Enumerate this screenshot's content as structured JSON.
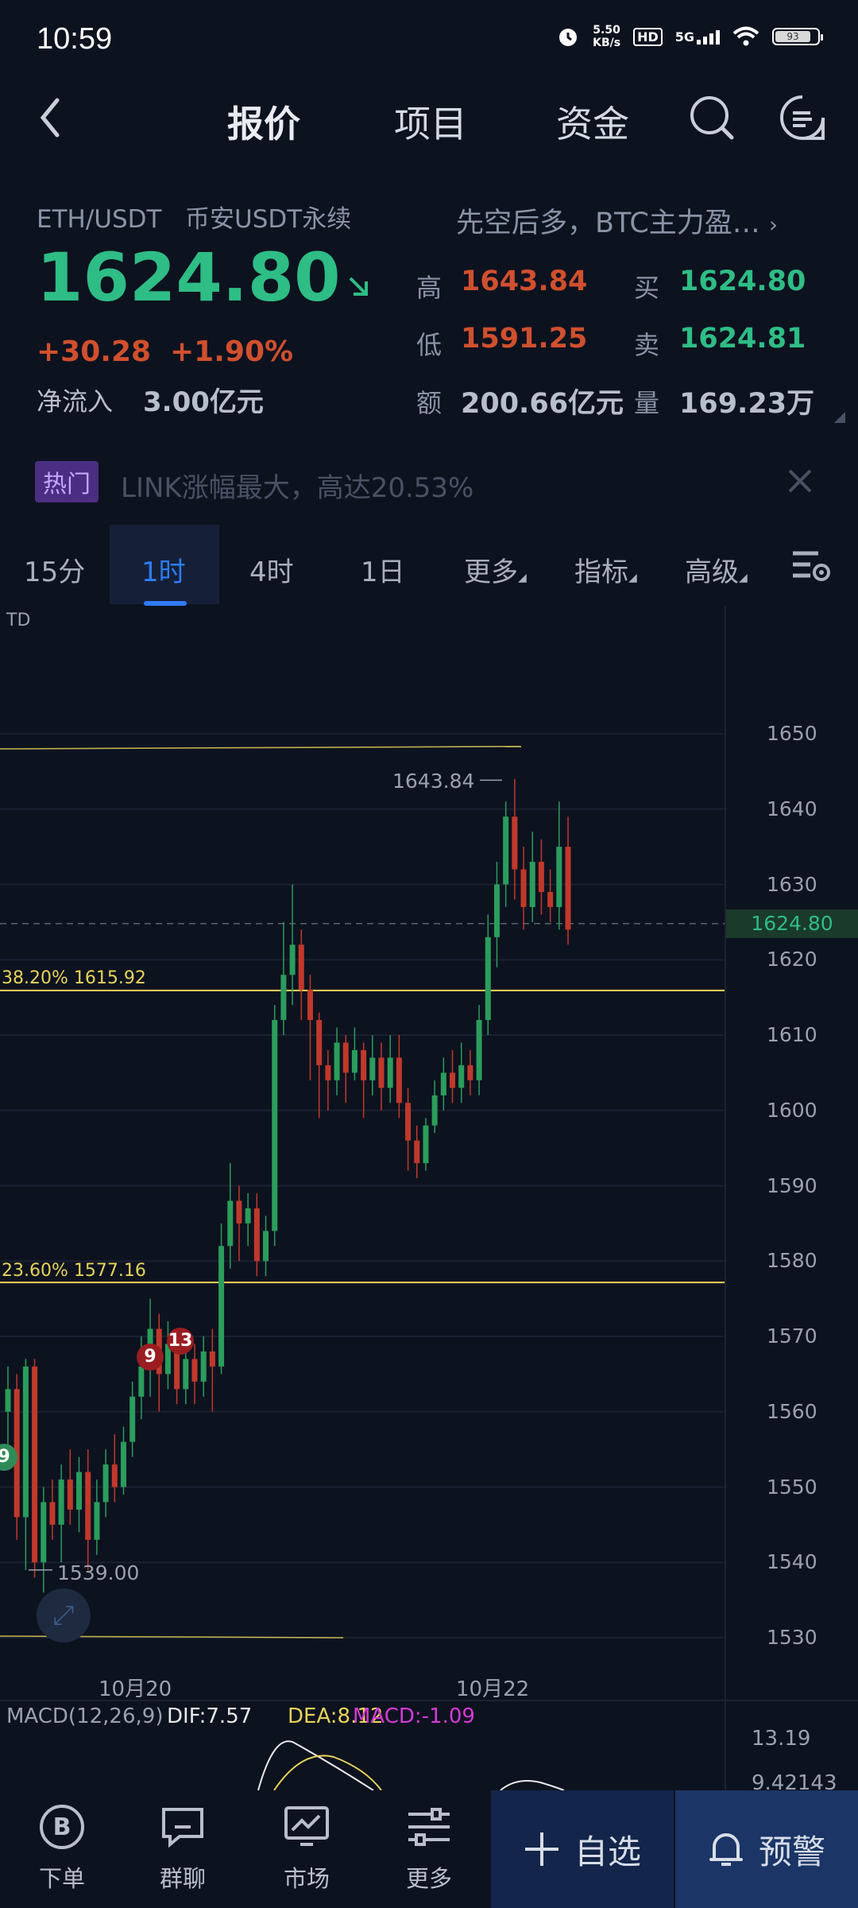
{
  "status": {
    "time": "10:59",
    "net_speed": "5.50",
    "net_unit": "KB/s",
    "hd": "HD",
    "signal": "5G",
    "battery": "93"
  },
  "nav": {
    "back_icon": "chevron-left-icon",
    "tabs": [
      "报价",
      "项目",
      "资金"
    ],
    "active_tab": "报价",
    "search_icon": "search-icon",
    "menu_icon": "message-menu-icon"
  },
  "quote": {
    "pair": "ETH/USDT",
    "market": "币安USDT永续",
    "headline": "先空后多，BTC主力盈…",
    "price": "1624.80",
    "change": "+30.28",
    "change_pct": "+1.90%",
    "netflow_label": "净流入",
    "netflow_value": "3.00亿元",
    "high_label": "高",
    "high": "1643.84",
    "low_label": "低",
    "low": "1591.25",
    "amount_label": "额",
    "amount": "200.66亿元",
    "bid_label": "买",
    "bid": "1624.80",
    "ask_label": "卖",
    "ask": "1624.81",
    "volume_label": "量",
    "volume": "169.23万",
    "colors": {
      "up": "#2ebd85",
      "down": "#d0502e"
    }
  },
  "hot": {
    "badge": "热门",
    "text": "LINK涨幅最大，高达20.53%",
    "close_icon": "close-icon"
  },
  "timeframes": {
    "items": [
      "15分",
      "1时",
      "4时",
      "1日",
      "更多",
      "指标",
      "高级"
    ],
    "active": "1时",
    "settings_icon": "chart-settings-icon"
  },
  "chart": {
    "indicator": "TD",
    "current_price_tag": "1624.80",
    "high_label": "1643.84",
    "low_label": "1539.00",
    "fib_382": "38.20% 1615.92",
    "fib_236": "23.60% 1577.16",
    "marker_9": "9",
    "marker_13": "13",
    "marker_side": "9",
    "x_labels": [
      "10月20",
      "10月22"
    ],
    "expand_icon": "expand-icon"
  },
  "chart_data": {
    "type": "candlestick",
    "ylim": [
      1525,
      1660
    ],
    "y_ticks": [
      1650,
      1640,
      1630,
      1620,
      1610,
      1600,
      1590,
      1580,
      1570,
      1560,
      1550,
      1540,
      1530
    ],
    "levels": {
      "fib_382": 1615.92,
      "fib_236": 1577.16,
      "current": 1624.8,
      "upper_line": 1648,
      "lower_line": 1530
    },
    "candles": [
      [
        1560,
        1563,
        1553,
        1566
      ],
      [
        1563,
        1546,
        1543,
        1565
      ],
      [
        1546,
        1566,
        1539,
        1567
      ],
      [
        1566,
        1540,
        1538,
        1567
      ],
      [
        1540,
        1548,
        1536,
        1550
      ],
      [
        1548,
        1545,
        1543,
        1551
      ],
      [
        1545,
        1551,
        1540,
        1553
      ],
      [
        1551,
        1547,
        1545,
        1555
      ],
      [
        1547,
        1552,
        1544,
        1554
      ],
      [
        1552,
        1543,
        1539,
        1555
      ],
      [
        1543,
        1548,
        1541,
        1551
      ],
      [
        1548,
        1553,
        1546,
        1555
      ],
      [
        1553,
        1550,
        1548,
        1557
      ],
      [
        1550,
        1556,
        1549,
        1558
      ],
      [
        1556,
        1562,
        1554,
        1564
      ],
      [
        1562,
        1566,
        1559,
        1570
      ],
      [
        1566,
        1571,
        1562,
        1575
      ],
      [
        1571,
        1565,
        1560,
        1573
      ],
      [
        1565,
        1569,
        1563,
        1572
      ],
      [
        1569,
        1563,
        1561,
        1570
      ],
      [
        1563,
        1567,
        1561,
        1569
      ],
      [
        1567,
        1564,
        1561,
        1569
      ],
      [
        1564,
        1568,
        1562,
        1570
      ],
      [
        1568,
        1566,
        1560,
        1571
      ],
      [
        1566,
        1582,
        1565,
        1585
      ],
      [
        1582,
        1588,
        1579,
        1593
      ],
      [
        1588,
        1585,
        1580,
        1590
      ],
      [
        1585,
        1587,
        1582,
        1589
      ],
      [
        1587,
        1580,
        1578,
        1589
      ],
      [
        1580,
        1584,
        1578,
        1586
      ],
      [
        1584,
        1612,
        1582,
        1614
      ],
      [
        1612,
        1618,
        1610,
        1625
      ],
      [
        1618,
        1622,
        1614,
        1630
      ],
      [
        1622,
        1616,
        1612,
        1624
      ],
      [
        1616,
        1612,
        1604,
        1618
      ],
      [
        1612,
        1606,
        1599,
        1613
      ],
      [
        1606,
        1604,
        1600,
        1608
      ],
      [
        1604,
        1609,
        1602,
        1611
      ],
      [
        1609,
        1605,
        1601,
        1610
      ],
      [
        1605,
        1608,
        1604,
        1611
      ],
      [
        1608,
        1604,
        1599,
        1609
      ],
      [
        1604,
        1607,
        1602,
        1610
      ],
      [
        1607,
        1603,
        1600,
        1609
      ],
      [
        1603,
        1607,
        1601,
        1610
      ],
      [
        1607,
        1601,
        1599,
        1610
      ],
      [
        1601,
        1596,
        1592,
        1603
      ],
      [
        1596,
        1593,
        1591,
        1598
      ],
      [
        1593,
        1598,
        1592,
        1599
      ],
      [
        1598,
        1602,
        1597,
        1604
      ],
      [
        1602,
        1605,
        1600,
        1607
      ],
      [
        1605,
        1603,
        1601,
        1608
      ],
      [
        1603,
        1606,
        1601,
        1609
      ],
      [
        1606,
        1604,
        1602,
        1608
      ],
      [
        1604,
        1612,
        1602,
        1614
      ],
      [
        1612,
        1623,
        1610,
        1626
      ],
      [
        1623,
        1630,
        1619,
        1633
      ],
      [
        1630,
        1639,
        1627,
        1641
      ],
      [
        1639,
        1632,
        1628,
        1644
      ],
      [
        1632,
        1627,
        1624,
        1635
      ],
      [
        1627,
        1633,
        1625,
        1637
      ],
      [
        1633,
        1629,
        1626,
        1636
      ],
      [
        1629,
        1627,
        1625,
        1632
      ],
      [
        1627,
        1635,
        1624,
        1641
      ],
      [
        1635,
        1624,
        1622,
        1639
      ]
    ]
  },
  "macd": {
    "label": "MACD(12,26,9)",
    "dif": "DIF:7.57",
    "dea": "DEA:8.12",
    "macd": "MACD:-1.09",
    "y1": "13.19",
    "y2": "9.42143",
    "colors": {
      "dif": "#e8e8e8",
      "dea": "#e8d35a",
      "macd": "#d63ad6"
    }
  },
  "bottom_nav": {
    "items": [
      {
        "label": "下单",
        "icon": "bitcoin-icon"
      },
      {
        "label": "群聊",
        "icon": "chat-icon"
      },
      {
        "label": "市场",
        "icon": "market-chart-icon"
      },
      {
        "label": "更多",
        "icon": "more-sliders-icon"
      }
    ],
    "favorite": "自选",
    "alert": "预警"
  }
}
